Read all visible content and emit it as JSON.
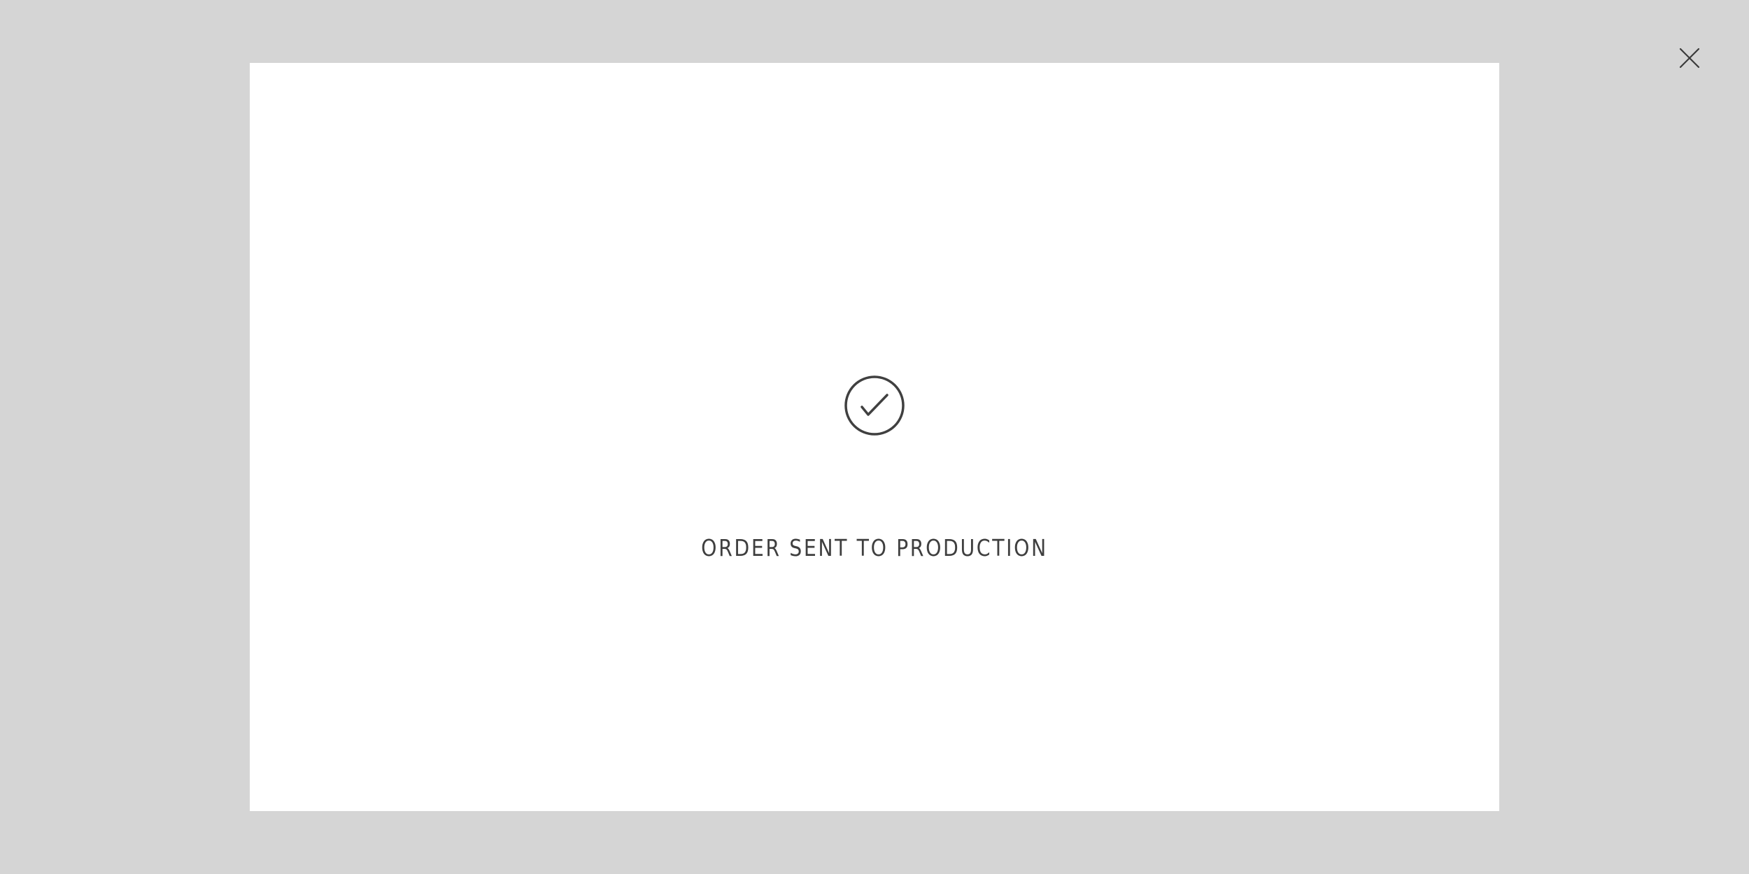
{
  "close_button": {
    "icon": "close-icon"
  },
  "modal": {
    "status_icon": "check-circle-icon",
    "message": "ORDER SENT TO PRODUCTION"
  },
  "colors": {
    "overlay_background": "#d5d5d5",
    "modal_background": "#ffffff",
    "text": "#3f3f3f",
    "icon_stroke": "#404040"
  }
}
